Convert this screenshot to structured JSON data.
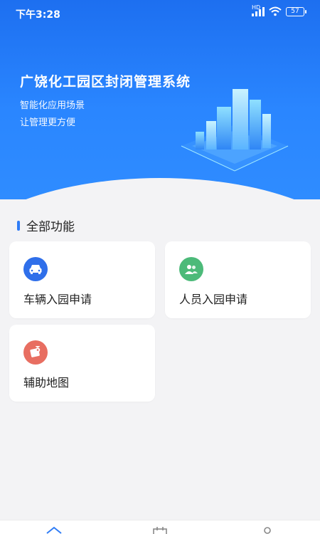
{
  "status_bar": {
    "time": "下午3:28",
    "network": "HD",
    "battery": "57"
  },
  "hero": {
    "title": "广饶化工园区封闭管理系统",
    "subtitle_line1": "智能化应用场景",
    "subtitle_line2": "让管理更方便"
  },
  "section": {
    "title": "全部功能"
  },
  "features": [
    {
      "label": "车辆入园申请",
      "icon": "car-icon",
      "icon_color": "#2f6fea"
    },
    {
      "label": "人员入园申请",
      "icon": "people-icon",
      "icon_color": "#4cba79"
    },
    {
      "label": "辅助地图",
      "icon": "map-icon",
      "icon_color": "#e86e61"
    }
  ],
  "bottom_nav": {
    "items": [
      "home-icon",
      "calendar-icon",
      "user-icon"
    ]
  }
}
